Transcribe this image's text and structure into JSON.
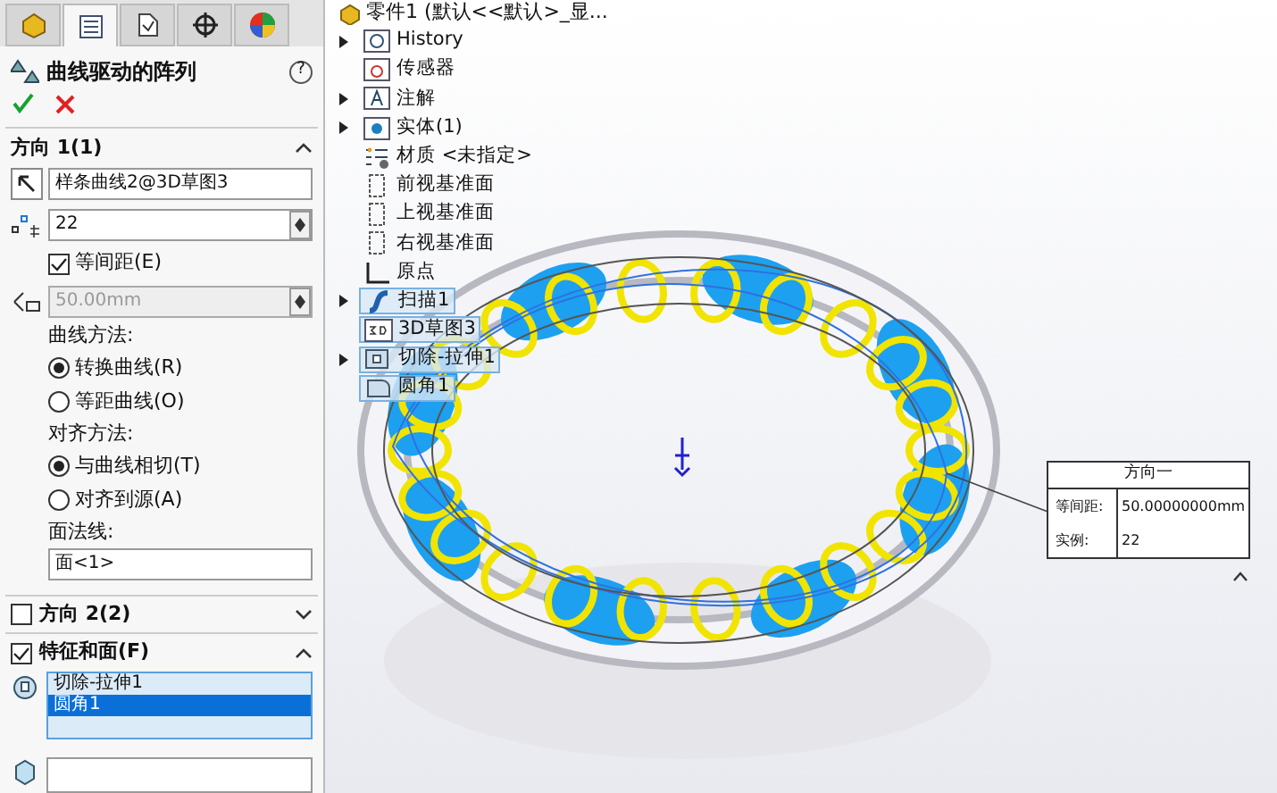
{
  "panel": {
    "tabs": [
      {
        "kind": "feature",
        "selected": false
      },
      {
        "kind": "property",
        "selected": true
      },
      {
        "kind": "config",
        "selected": false
      },
      {
        "kind": "dimxpert",
        "selected": false
      },
      {
        "kind": "display",
        "selected": false
      }
    ],
    "title": "曲线驱动的阵列",
    "help": "?",
    "direction1": {
      "title": "方向 1(1)",
      "expanded": true,
      "path": "样条曲线2@3D草图3",
      "count": "22",
      "equal_spacing": {
        "label": "等间距(E)",
        "checked": true
      },
      "spacing": {
        "value": "50.00mm",
        "disabled": true
      },
      "curve_method": {
        "label": "曲线方法:",
        "options": [
          {
            "label": "转换曲线(R)",
            "selected": true
          },
          {
            "label": "等距曲线(O)",
            "selected": false
          }
        ]
      },
      "align_method": {
        "label": "对齐方法:",
        "options": [
          {
            "label": "与曲线相切(T)",
            "selected": true
          },
          {
            "label": "对齐到源(A)",
            "selected": false
          }
        ]
      },
      "normal_label": "面法线:",
      "normal_value": "面<1>"
    },
    "direction2": {
      "title": "方向 2(2)",
      "checked": false,
      "expanded": false
    },
    "features": {
      "title": "特征和面(F)",
      "checked": true,
      "expanded": true,
      "items": [
        {
          "label": "切除-拉伸1",
          "selected": false
        },
        {
          "label": "圆角1",
          "selected": true
        }
      ]
    }
  },
  "tree": {
    "root": "零件1 (默认<<默认>_显...",
    "items": [
      {
        "label": "History",
        "kind": "history",
        "has_children": true,
        "selected": false
      },
      {
        "label": "传感器",
        "kind": "sensor",
        "has_children": false,
        "selected": false
      },
      {
        "label": "注解",
        "kind": "annotation",
        "has_children": true,
        "selected": false
      },
      {
        "label": "实体(1)",
        "kind": "body",
        "has_children": true,
        "selected": false
      },
      {
        "label": "材质 <未指定>",
        "kind": "material",
        "has_children": false,
        "selected": false
      },
      {
        "label": "前视基准面",
        "kind": "plane",
        "has_children": false,
        "selected": false
      },
      {
        "label": "上视基准面",
        "kind": "plane",
        "has_children": false,
        "selected": false
      },
      {
        "label": "右视基准面",
        "kind": "plane",
        "has_children": false,
        "selected": false
      },
      {
        "label": "原点",
        "kind": "origin",
        "has_children": false,
        "selected": false
      },
      {
        "label": "扫描1",
        "kind": "sweep",
        "has_children": true,
        "selected": true
      },
      {
        "label": "3D草图3",
        "kind": "sketch",
        "has_children": false,
        "selected": true
      },
      {
        "label": "切除-拉伸1",
        "kind": "cut",
        "has_children": true,
        "selected": true
      },
      {
        "label": "圆角1",
        "kind": "fillet",
        "has_children": false,
        "selected": true
      }
    ]
  },
  "callout": {
    "title": "方向一",
    "rows": [
      {
        "label": "等间距:",
        "value": "50.00000000mm"
      },
      {
        "label": "实例:",
        "value": "22"
      }
    ]
  }
}
